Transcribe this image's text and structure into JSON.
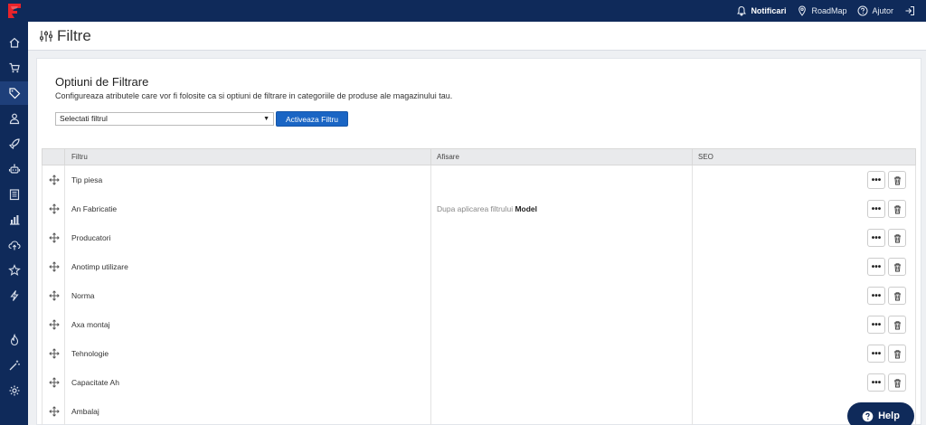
{
  "topbar": {
    "notifications_label": "Notificari",
    "roadmap_label": "RoadMap",
    "help_label": "Ajutor"
  },
  "sidebar": {
    "items": [
      "home-icon",
      "cart-icon",
      "tag-icon",
      "users-icon",
      "rocket-icon",
      "robot-icon",
      "book-icon",
      "chart-icon",
      "cloud-upload-icon",
      "star-icon",
      "bolt-icon",
      "fire-icon",
      "magic-wand-icon",
      "gear-icon"
    ],
    "active": "tag-icon"
  },
  "header": {
    "title": "Filtre"
  },
  "card": {
    "title": "Optiuni de Filtrare",
    "description": "Configureaza atributele care vor fi folosite ca si optiuni de filtrare in categoriile de produse ale magazinului tau.",
    "select_value": "Selectati filtrul",
    "activate_label": "Activeaza Filtru"
  },
  "table": {
    "headers": [
      "Filtru",
      "Afisare",
      "SEO"
    ],
    "rows": [
      {
        "name": "Tip piesa",
        "afis_prefix": "",
        "afis_bold": ""
      },
      {
        "name": "An Fabricatie",
        "afis_prefix": "Dupa aplicarea filtrului ",
        "afis_bold": "Model"
      },
      {
        "name": "Producatori",
        "afis_prefix": "",
        "afis_bold": ""
      },
      {
        "name": "Anotimp utilizare",
        "afis_prefix": "",
        "afis_bold": ""
      },
      {
        "name": "Norma",
        "afis_prefix": "",
        "afis_bold": ""
      },
      {
        "name": "Axa montaj",
        "afis_prefix": "",
        "afis_bold": ""
      },
      {
        "name": "Tehnologie",
        "afis_prefix": "",
        "afis_bold": ""
      },
      {
        "name": "Capacitate Ah",
        "afis_prefix": "",
        "afis_bold": ""
      },
      {
        "name": "Ambalaj",
        "afis_prefix": "",
        "afis_bold": ""
      }
    ],
    "more_label": "•••"
  },
  "help_button": {
    "label": "Help"
  },
  "colors": {
    "navy": "#0f2a5a",
    "primary": "#1a65c4",
    "logo_red": "#e8232b"
  }
}
